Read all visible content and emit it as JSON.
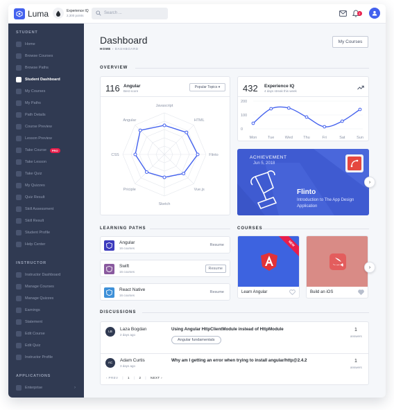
{
  "app": {
    "name": "Luma",
    "experience_title": "Experience IQ",
    "experience_points": "2,300 points",
    "search_placeholder": "Search ...",
    "notification_count": "2"
  },
  "sidebar": {
    "sections": [
      {
        "heading": "STUDENT",
        "items": [
          {
            "label": "Home"
          },
          {
            "label": "Browse Courses"
          },
          {
            "label": "Browse Paths"
          },
          {
            "label": "Student Dashboard",
            "active": true
          },
          {
            "label": "My Courses"
          },
          {
            "label": "My Paths"
          },
          {
            "label": "Path Details"
          },
          {
            "label": "Course Preview"
          },
          {
            "label": "Lesson Preview"
          },
          {
            "label": "Take Course",
            "badge": "PRO"
          },
          {
            "label": "Take Lesson"
          },
          {
            "label": "Take Quiz"
          },
          {
            "label": "My Quizzes"
          },
          {
            "label": "Quiz Result"
          },
          {
            "label": "Skill Assessment"
          },
          {
            "label": "Skill Result"
          },
          {
            "label": "Student Profile"
          },
          {
            "label": "Help Center"
          }
        ]
      },
      {
        "heading": "INSTRUCTOR",
        "items": [
          {
            "label": "Instructor Dashboard"
          },
          {
            "label": "Manage Courses"
          },
          {
            "label": "Manage Quizzes"
          },
          {
            "label": "Earnings"
          },
          {
            "label": "Statement"
          },
          {
            "label": "Edit Course"
          },
          {
            "label": "Edit Quiz"
          },
          {
            "label": "Instructor Profile"
          }
        ]
      },
      {
        "heading": "APPLICATIONS",
        "items": [
          {
            "label": "Enterprise",
            "chevron": "›"
          }
        ]
      }
    ]
  },
  "header": {
    "title": "Dashboard",
    "breadcrumb_home": "HOME",
    "breadcrumb_sep": "›",
    "breadcrumb_current": "DASHBOARD",
    "my_courses_button": "My Courses"
  },
  "overview": {
    "label": "OVERVIEW",
    "angular_card": {
      "score": "116",
      "title": "Angular",
      "subtitle": "Best score",
      "dropdown": "Popular Topics ▾"
    },
    "experience_card": {
      "score": "432",
      "title": "Experience IQ",
      "subtitle": "4 days streak this week"
    }
  },
  "chart_data": [
    {
      "type": "radar",
      "categories": [
        "Javascript",
        "HTML",
        "Flinto",
        "Vue.js",
        "Sketch",
        "Priciple",
        "CSS",
        "Angular"
      ],
      "values": [
        70,
        75,
        80,
        65,
        55,
        60,
        70,
        82
      ],
      "rmax": 100,
      "color": "#4361ee"
    },
    {
      "type": "line",
      "categories": [
        "Mon",
        "Tue",
        "Wed",
        "Thu",
        "Fri",
        "Sat",
        "Sun"
      ],
      "values": [
        40,
        145,
        150,
        85,
        15,
        55,
        140
      ],
      "yticks": [
        0,
        100,
        200
      ],
      "ylim": [
        0,
        200
      ],
      "color": "#4361ee"
    }
  ],
  "achievement": {
    "label": "ACHIEVEMENT",
    "date": "Jun 5, 2018",
    "title": "Flinto",
    "description": "Introduction to The App Design Application",
    "next": "›"
  },
  "learning_paths": {
    "label": "LEARNING PATHS",
    "items": [
      {
        "name": "Angular",
        "count": "16 courses",
        "action": "Resume",
        "color": "#3d3bbd"
      },
      {
        "name": "Swift",
        "count": "16 courses",
        "action": "Resume",
        "color": "#8a5a9f"
      },
      {
        "name": "React Native",
        "count": "16 courses",
        "action": "Resume",
        "color": "#3e90d8"
      }
    ]
  },
  "courses": {
    "label": "COURSES",
    "items": [
      {
        "name": "Learn Angular",
        "ribbon": "NEW",
        "color": "#3d63e0"
      },
      {
        "name": "Build an iOS",
        "ribbon": "",
        "color": "#d98b86"
      }
    ],
    "next": "›"
  },
  "discussions": {
    "label": "DISCUSSIONS",
    "items": [
      {
        "initials": "LB",
        "name": "Laza Bogdan",
        "time": "2 days ago",
        "question": "Using Angular HttpClientModule instead of HttpModule",
        "tag": "Angular fundamentals",
        "answers": "1",
        "answers_label": "answers"
      },
      {
        "initials": "AC",
        "name": "Adam Curtis",
        "time": "3 days ago",
        "question": "Why am I getting an error when trying to install angular/http@2.4.2",
        "tag": "",
        "answers": "1",
        "answers_label": "answers"
      }
    ],
    "pagination": {
      "prev": "‹ PREV",
      "pages": [
        "1",
        "2"
      ],
      "next": "NEXT ›"
    }
  }
}
